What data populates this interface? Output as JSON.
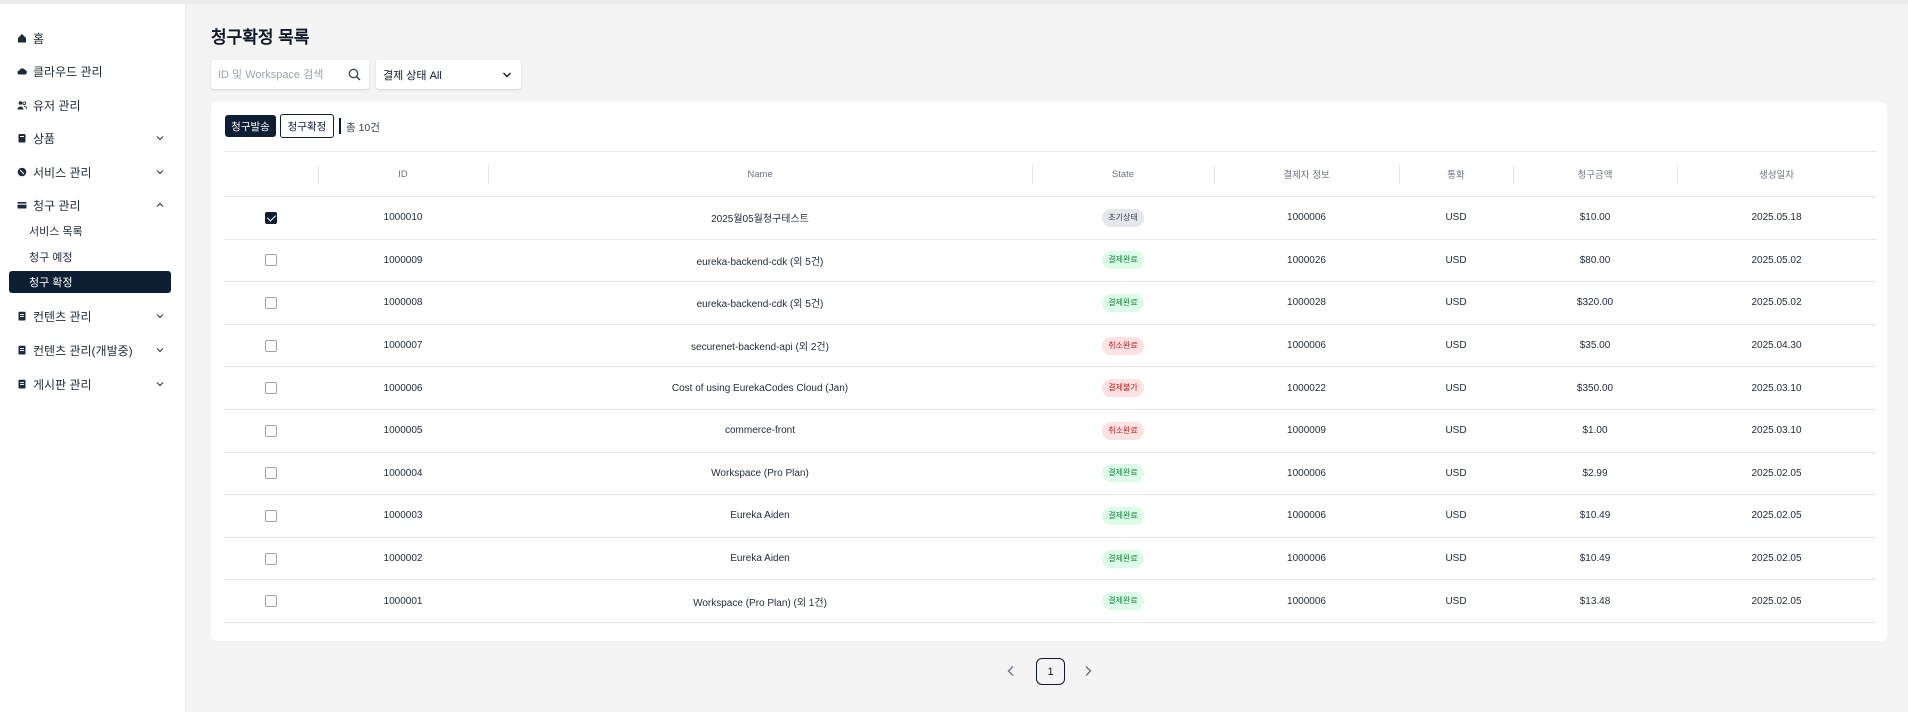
{
  "colors": {
    "accent_dark": "#0f1f33",
    "badge_init_bg": "#e5e7eb",
    "badge_init_fg": "#374151",
    "badge_paid_bg": "#dcfce7",
    "badge_paid_fg": "#15803d",
    "badge_cancel_bg": "#fee2e2",
    "badge_cancel_fg": "#b91c1c"
  },
  "sidebar": {
    "items": [
      {
        "label": "홈",
        "icon": "home-icon"
      },
      {
        "label": "클라우드 관리",
        "icon": "cloud-icon"
      },
      {
        "label": "유저 관리",
        "icon": "users-icon"
      },
      {
        "label": "상품",
        "icon": "box-icon",
        "expandable": true
      },
      {
        "label": "서비스 관리",
        "icon": "service-icon",
        "expandable": true
      },
      {
        "label": "청구 관리",
        "icon": "card-icon",
        "expandable": true,
        "expanded": true
      },
      {
        "label": "컨텐츠 관리",
        "icon": "document-icon",
        "expandable": true
      },
      {
        "label": "컨텐츠 관리(개발중)",
        "icon": "document-icon",
        "expandable": true
      },
      {
        "label": "게시판 관리",
        "icon": "document-icon",
        "expandable": true
      }
    ],
    "billing_sub": [
      {
        "label": "서비스 목록"
      },
      {
        "label": "청구 예정"
      },
      {
        "label": "청구 확정",
        "active": true
      }
    ]
  },
  "page": {
    "title": "청구확정 목록"
  },
  "search": {
    "placeholder": "ID 및 Workspace 검색",
    "value": ""
  },
  "filter": {
    "label": "결제 상태 All"
  },
  "toolbar": {
    "send_label": "청구발송",
    "confirm_label": "청구확정",
    "total_label": "총 10건"
  },
  "table": {
    "columns": [
      "",
      "ID",
      "Name",
      "State",
      "결제자 정보",
      "통화",
      "청구금액",
      "생성일자"
    ],
    "rows": [
      {
        "checked": true,
        "id": "1000010",
        "name": "2025월05월청구테스트",
        "state": "초기상태",
        "state_kind": "init",
        "payer": "1000006",
        "currency": "USD",
        "amount": "$10.00",
        "date": "2025.05.18"
      },
      {
        "checked": false,
        "id": "1000009",
        "name": "eureka-backend-cdk (외 5건)",
        "state": "결제완료",
        "state_kind": "paid",
        "payer": "1000026",
        "currency": "USD",
        "amount": "$80.00",
        "date": "2025.05.02"
      },
      {
        "checked": false,
        "id": "1000008",
        "name": "eureka-backend-cdk (외 5건)",
        "state": "결제완료",
        "state_kind": "paid",
        "payer": "1000028",
        "currency": "USD",
        "amount": "$320.00",
        "date": "2025.05.02"
      },
      {
        "checked": false,
        "id": "1000007",
        "name": "securenet-backend-api (외 2건)",
        "state": "취소완료",
        "state_kind": "cancel",
        "payer": "1000006",
        "currency": "USD",
        "amount": "$35.00",
        "date": "2025.04.30"
      },
      {
        "checked": false,
        "id": "1000006",
        "name": "Cost of using EurekaCodes Cloud (Jan)",
        "state": "결제불가",
        "state_kind": "cancel",
        "payer": "1000022",
        "currency": "USD",
        "amount": "$350.00",
        "date": "2025.03.10"
      },
      {
        "checked": false,
        "id": "1000005",
        "name": "commerce-front",
        "state": "취소완료",
        "state_kind": "cancel",
        "payer": "1000009",
        "currency": "USD",
        "amount": "$1.00",
        "date": "2025.03.10"
      },
      {
        "checked": false,
        "id": "1000004",
        "name": "Workspace (Pro Plan)",
        "state": "결제완료",
        "state_kind": "paid",
        "payer": "1000006",
        "currency": "USD",
        "amount": "$2.99",
        "date": "2025.02.05"
      },
      {
        "checked": false,
        "id": "1000003",
        "name": "Eureka Aiden",
        "state": "결제완료",
        "state_kind": "paid",
        "payer": "1000006",
        "currency": "USD",
        "amount": "$10.49",
        "date": "2025.02.05"
      },
      {
        "checked": false,
        "id": "1000002",
        "name": "Eureka Aiden",
        "state": "결제완료",
        "state_kind": "paid",
        "payer": "1000006",
        "currency": "USD",
        "amount": "$10.49",
        "date": "2025.02.05"
      },
      {
        "checked": false,
        "id": "1000001",
        "name": "Workspace (Pro Plan) (외 1건)",
        "state": "결제완료",
        "state_kind": "paid",
        "payer": "1000006",
        "currency": "USD",
        "amount": "$13.48",
        "date": "2025.02.05"
      }
    ]
  },
  "pagination": {
    "current": "1"
  }
}
